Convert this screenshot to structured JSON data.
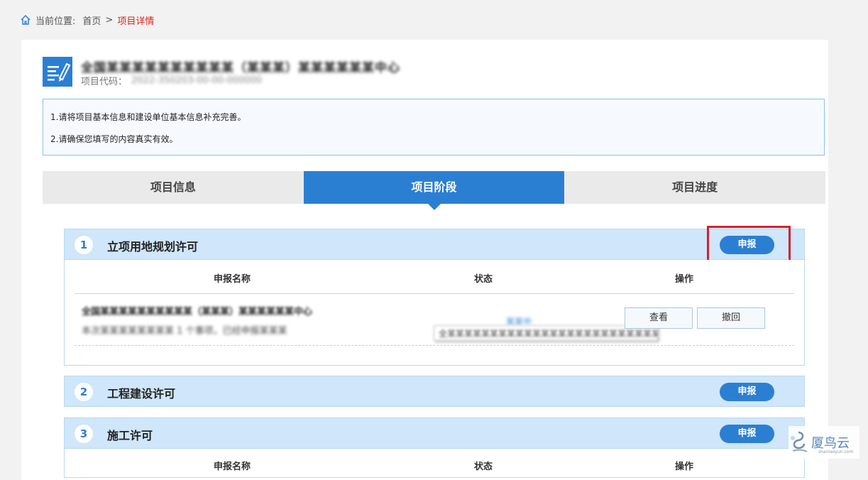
{
  "breadcrumb": {
    "prefix": "当前位置:",
    "home": "首页",
    "separator": ">",
    "current": "项目详情"
  },
  "project": {
    "name": "全国某某某某某某某某某某（某某某）某某某某某某中心",
    "code_label": "项目代码：",
    "code_value": "2022-350203-00-00-000000"
  },
  "notices": [
    "1.请将项目基本信息和建设单位基本信息补充完善。",
    "2.请确保您填写的内容真实有效。"
  ],
  "tabs": [
    "项目信息",
    "项目阶段",
    "项目进度"
  ],
  "active_tab": "项目阶段",
  "table_headers": {
    "name": "申报名称",
    "status": "状态",
    "action": "操作"
  },
  "stages": [
    {
      "number": "1",
      "title": "立项用地规划许可",
      "report_button": "申报",
      "rows": [
        {
          "name": "全国某某某某某某某某某某（某某某）某某某某某某中心",
          "description": "本次某某某某某某某某 1 个事项，已经申报某某某",
          "status": "某某中",
          "tooltip": "全某某某某某某某某某某某某某某某某某某某某某某某某某某",
          "buttons": [
            "查看",
            "撤回"
          ]
        }
      ]
    },
    {
      "number": "2",
      "title": "工程建设许可",
      "report_button": "申报"
    },
    {
      "number": "3",
      "title": "施工许可",
      "report_button": "申报"
    }
  ],
  "watermark": {
    "text": "厦鸟云",
    "sub": "shaniaoyun.com"
  },
  "colors": {
    "primary": "#2b7fd3",
    "highlight": "#d6202b",
    "stage_header": "#cfe6fb",
    "breadcrumb_current": "#d9251c"
  }
}
